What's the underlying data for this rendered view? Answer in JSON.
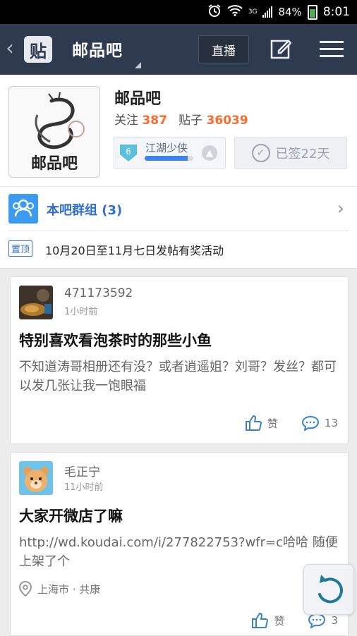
{
  "status_bar": {
    "signal_label": "3G",
    "battery": "84%",
    "time": "8:01"
  },
  "nav": {
    "back_glyph": "‹",
    "logo_char": "贴",
    "title": "邮品吧",
    "live_label": "直播"
  },
  "forum": {
    "name": "邮品吧",
    "follow_label": "关注",
    "follow_count": "387",
    "posts_label": "贴子",
    "posts_count": "36039",
    "avatar_text": "邮品吧",
    "level": {
      "number": "6",
      "title": "江湖少侠",
      "progress_pct": 88
    },
    "sign_label": "已签22天",
    "group_label": "本吧群组 (3)",
    "pinned": {
      "tag": "置顶",
      "text": "10月20日至11月七日发帖有奖活动"
    }
  },
  "posts": [
    {
      "user": "471173592",
      "time": "1小时前",
      "title": "特别喜欢看泡茶时的那些小鱼",
      "body": "不知道涛哥相册还有没？或者逍遥姐？刘哥？发丝？都可以发几张让我一饱眼福",
      "like_label": "赞",
      "comments": "13"
    },
    {
      "user": "毛正宁",
      "time": "11小时前",
      "title": "大家开微店了嘛",
      "body": "http://wd.koudai.com/i/277822753?wfr=c哈哈 随便上架了个",
      "location": "上海市 · 共康",
      "like_label": "赞",
      "comments": "3"
    }
  ],
  "colors": {
    "nav_bg": "#2e3a4e",
    "accent_orange": "#ff6a2c",
    "link_blue": "#2f6fcf"
  }
}
